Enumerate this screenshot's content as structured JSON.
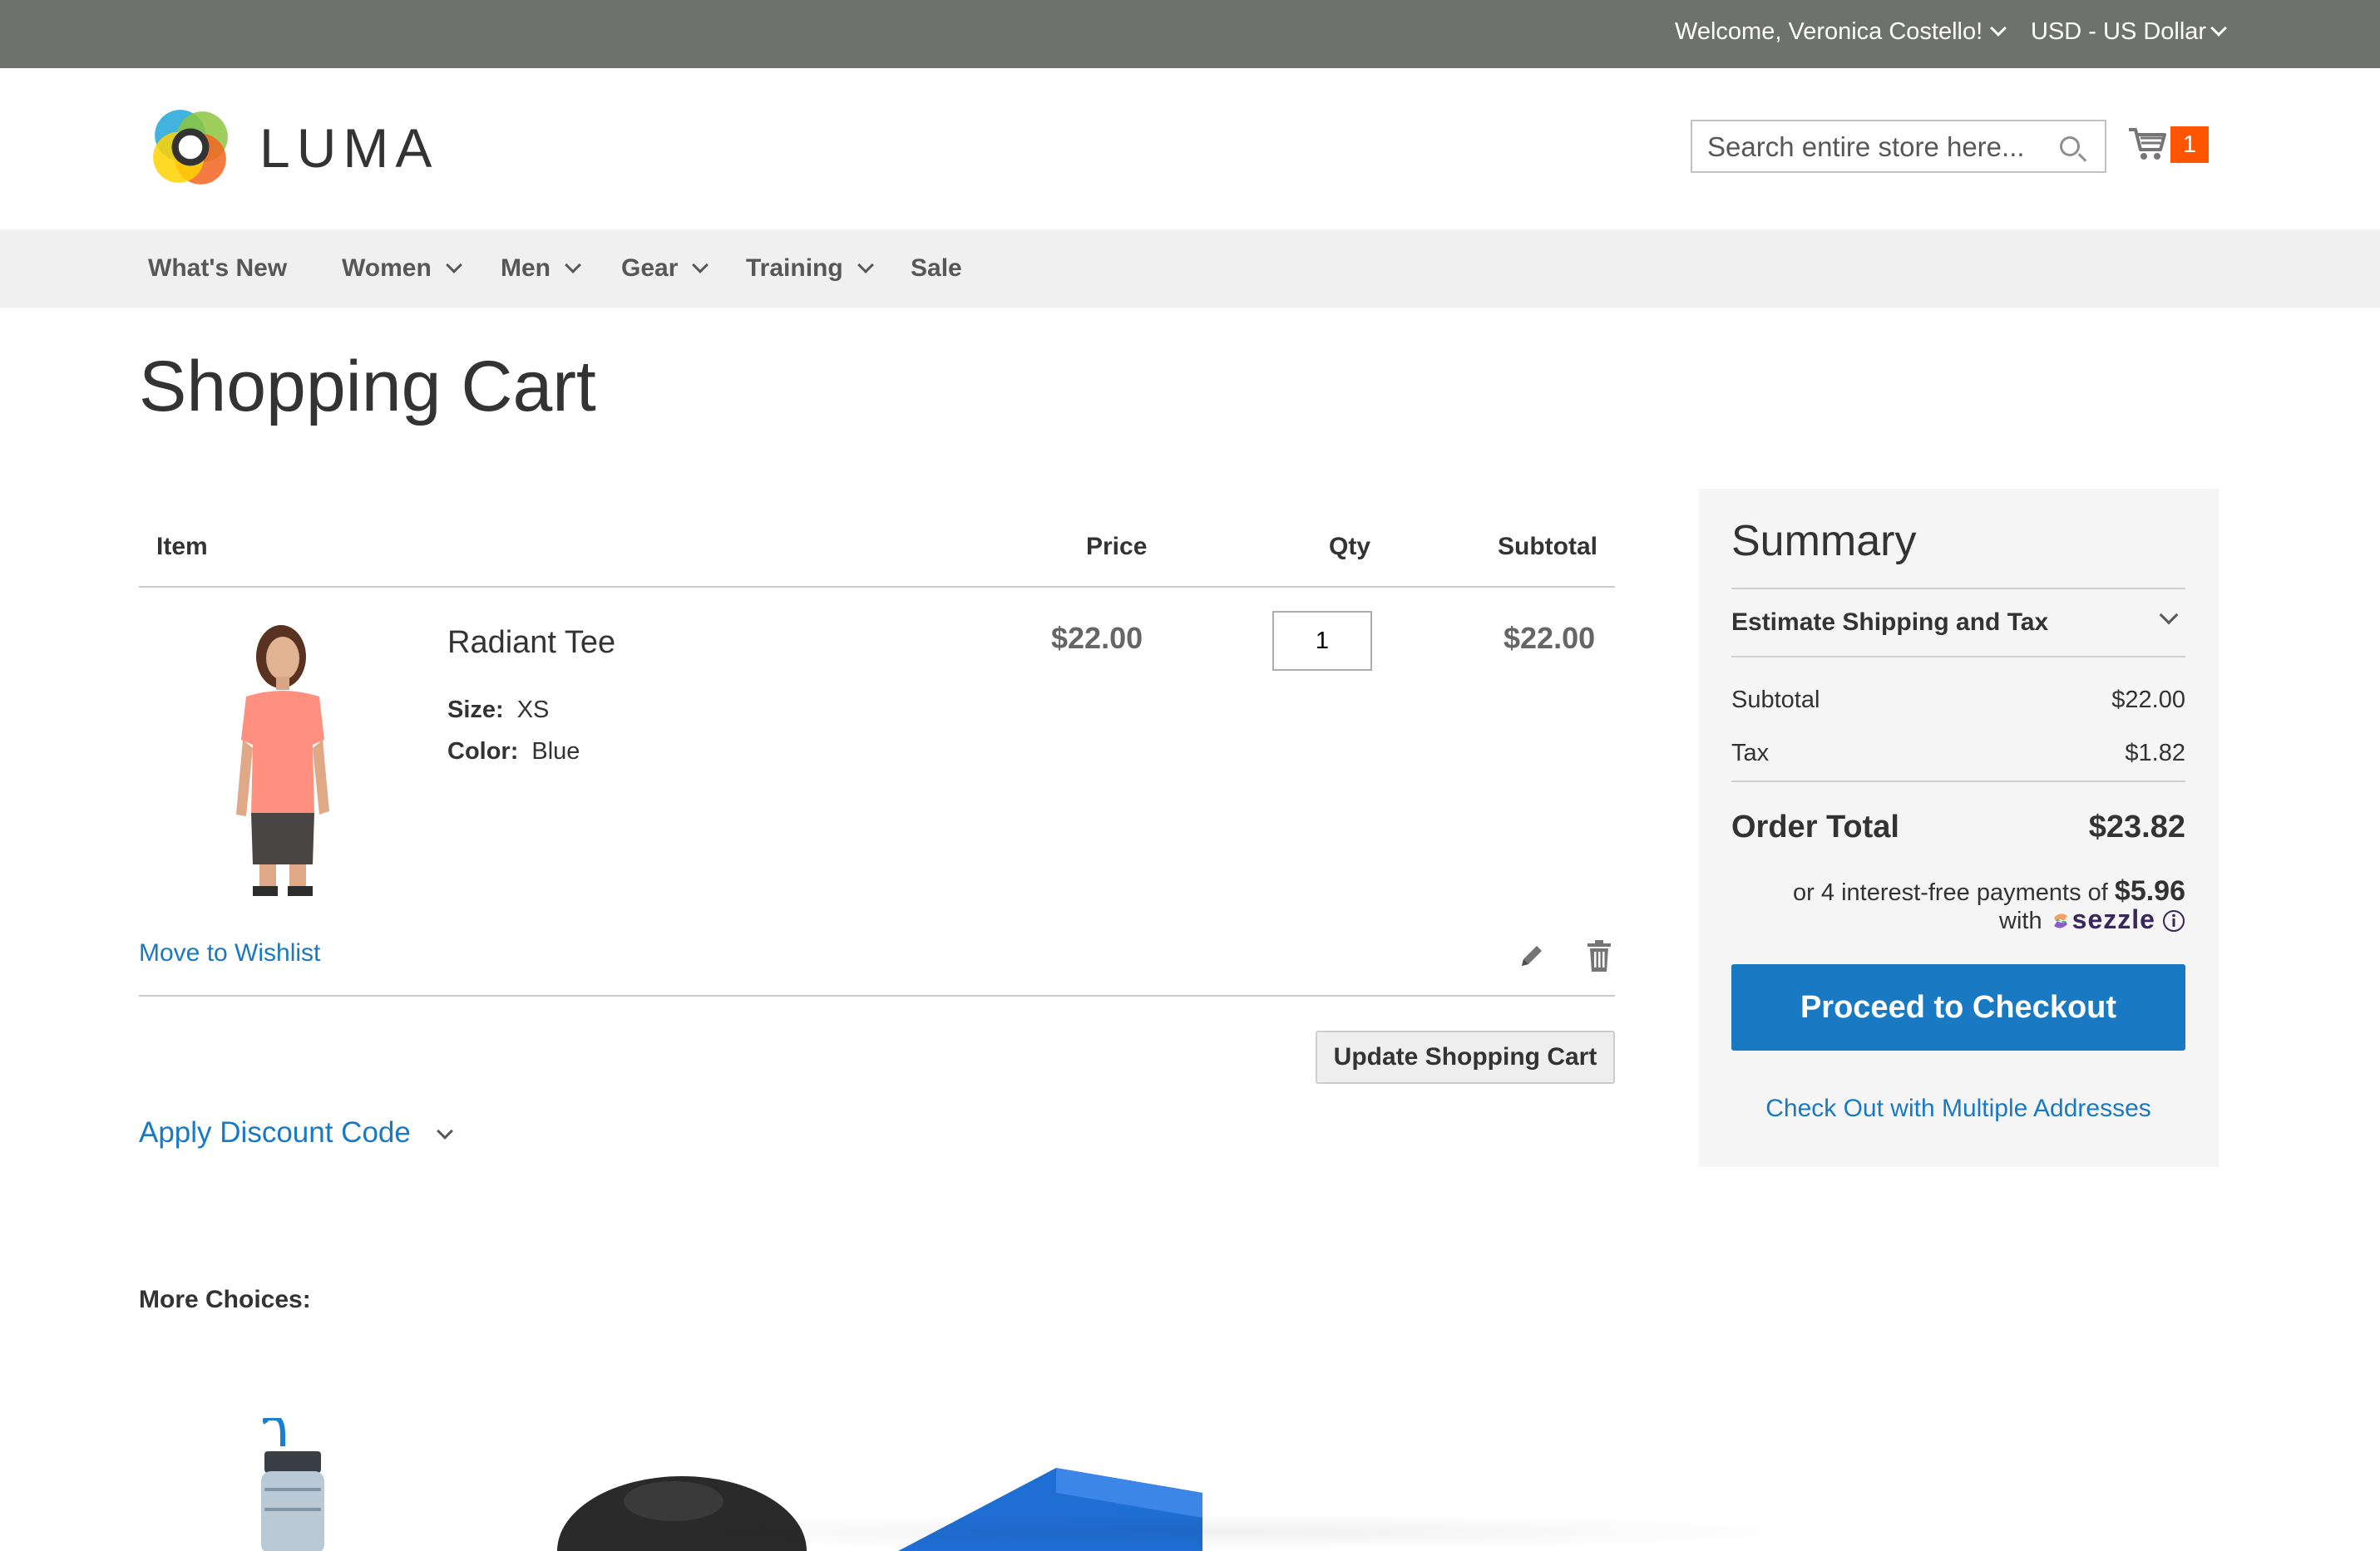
{
  "topbar": {
    "welcome": "Welcome, Veronica Costello!",
    "currency": "USD - US Dollar"
  },
  "header": {
    "logo_text": "LUMA",
    "search_placeholder": "Search entire store here...",
    "cart_count": "1"
  },
  "nav": {
    "items": [
      {
        "label": "What's New",
        "dropdown": false
      },
      {
        "label": "Women",
        "dropdown": true
      },
      {
        "label": "Men",
        "dropdown": true
      },
      {
        "label": "Gear",
        "dropdown": true
      },
      {
        "label": "Training",
        "dropdown": true
      },
      {
        "label": "Sale",
        "dropdown": false
      }
    ]
  },
  "page_title": "Shopping Cart",
  "cart": {
    "headers": {
      "item": "Item",
      "price": "Price",
      "qty": "Qty",
      "subtotal": "Subtotal"
    },
    "items": [
      {
        "name": "Radiant Tee",
        "options": [
          {
            "label": "Size:",
            "value": "XS"
          },
          {
            "label": "Color:",
            "value": "Blue"
          }
        ],
        "price": "$22.00",
        "qty": "1",
        "subtotal": "$22.00",
        "wishlist_label": "Move to Wishlist"
      }
    ],
    "update_label": "Update Shopping Cart",
    "discount_label": "Apply Discount Code",
    "more_choices": "More Choices:"
  },
  "summary": {
    "title": "Summary",
    "estimate_label": "Estimate Shipping and Tax",
    "subtotal_label": "Subtotal",
    "subtotal_value": "$22.00",
    "tax_label": "Tax",
    "tax_value": "$1.82",
    "total_label": "Order Total",
    "total_value": "$23.82",
    "sezzle_prefix": "or 4 interest-free payments of",
    "sezzle_amount": "$5.96",
    "sezzle_with": "with",
    "sezzle_brand": "sezzle",
    "checkout_label": "Proceed to Checkout",
    "multi_label": "Check Out with Multiple Addresses"
  },
  "colors": {
    "topbar": "#6e716e",
    "link": "#1979c3",
    "primary_button": "#1979c3",
    "cart_badge": "#ff5501",
    "nav_bg": "#f0f0f0",
    "summary_bg": "#f5f5f5"
  }
}
